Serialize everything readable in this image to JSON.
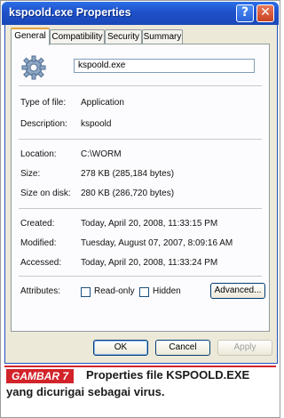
{
  "window": {
    "title": "kspoold.exe Properties",
    "help_glyph": "?",
    "close_glyph": "✕"
  },
  "tabs": [
    {
      "label": "General"
    },
    {
      "label": "Compatibility"
    },
    {
      "label": "Security"
    },
    {
      "label": "Summary"
    }
  ],
  "general": {
    "file_name": "kspoold.exe",
    "type_label": "Type of file:",
    "type_value": "Application",
    "desc_label": "Description:",
    "desc_value": "kspoold",
    "location_label": "Location:",
    "location_value": "C:\\WORM",
    "size_label": "Size:",
    "size_value": "278 KB (285,184 bytes)",
    "size_disk_label": "Size on disk:",
    "size_disk_value": "280 KB (286,720 bytes)",
    "created_label": "Created:",
    "created_value": "Today, April 20, 2008, 11:33:15 PM",
    "modified_label": "Modified:",
    "modified_value": "Tuesday, August 07, 2007, 8:09:16 AM",
    "accessed_label": "Accessed:",
    "accessed_value": "Today, April 20, 2008, 11:33:24 PM",
    "attributes_label": "Attributes:",
    "readonly_label": "Read-only",
    "hidden_label": "Hidden",
    "advanced_label": "Advanced..."
  },
  "buttons": {
    "ok": "OK",
    "cancel": "Cancel",
    "apply": "Apply"
  },
  "caption": {
    "figure_tag": "GAMBAR 7",
    "line1": "Properties file KSPOOLD.EXE",
    "line2": "yang dicurigai sebagai virus."
  },
  "colors": {
    "titlebar": "#1e50c9",
    "caption_accent": "#d2232a",
    "dialog_bg": "#ece9d8"
  }
}
